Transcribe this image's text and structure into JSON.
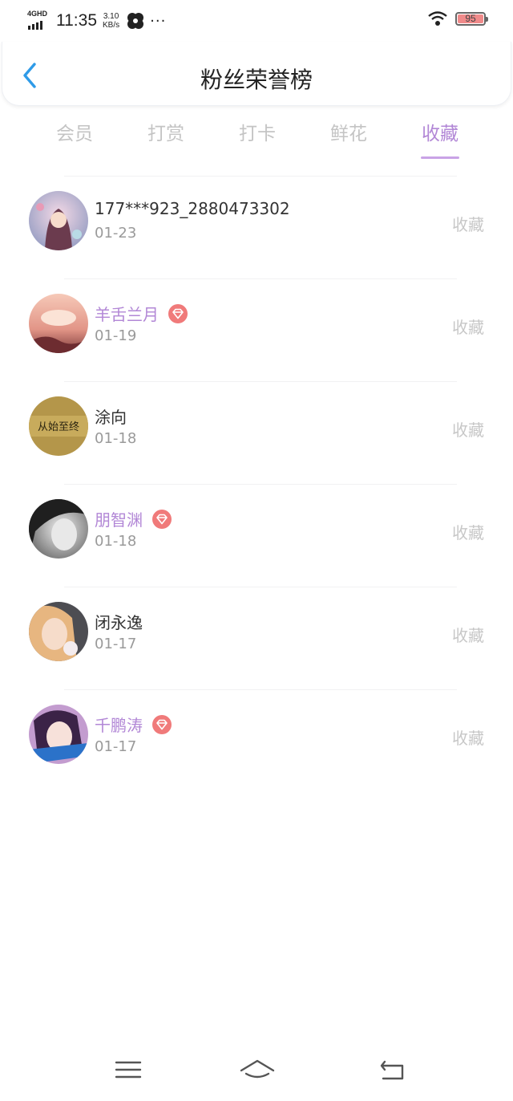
{
  "status_bar": {
    "network": "4GHD",
    "time": "11:35",
    "speed_value": "3.10",
    "speed_unit": "KB/s",
    "more": "···",
    "battery": "95"
  },
  "header": {
    "title": "粉丝荣誉榜"
  },
  "tabs": [
    {
      "label": "会员",
      "active": false
    },
    {
      "label": "打赏",
      "active": false
    },
    {
      "label": "打卡",
      "active": false
    },
    {
      "label": "鲜花",
      "active": false
    },
    {
      "label": "收藏",
      "active": true
    }
  ],
  "fans": [
    {
      "name": "177***923_2880473302",
      "date": "01-23",
      "action": "收藏",
      "vip": false
    },
    {
      "name": "羊舌兰月",
      "date": "01-19",
      "action": "收藏",
      "vip": true
    },
    {
      "name": "涂向",
      "date": "01-18",
      "action": "收藏",
      "vip": false,
      "avatar_text": "从始至终"
    },
    {
      "name": "朋智渊",
      "date": "01-18",
      "action": "收藏",
      "vip": true
    },
    {
      "name": "闭永逸",
      "date": "01-17",
      "action": "收藏",
      "vip": false
    },
    {
      "name": "千鹏涛",
      "date": "01-17",
      "action": "收藏",
      "vip": true
    }
  ],
  "colors": {
    "accent": "#b287d6",
    "back_arrow": "#2f9be8",
    "gem": "#f07a7a",
    "muted": "#c7c7c7"
  },
  "icons": {
    "back": "chevron-left-icon",
    "gem": "diamond-icon",
    "nav_menu": "menu-icon",
    "nav_home": "home-icon",
    "nav_back": "return-icon"
  }
}
